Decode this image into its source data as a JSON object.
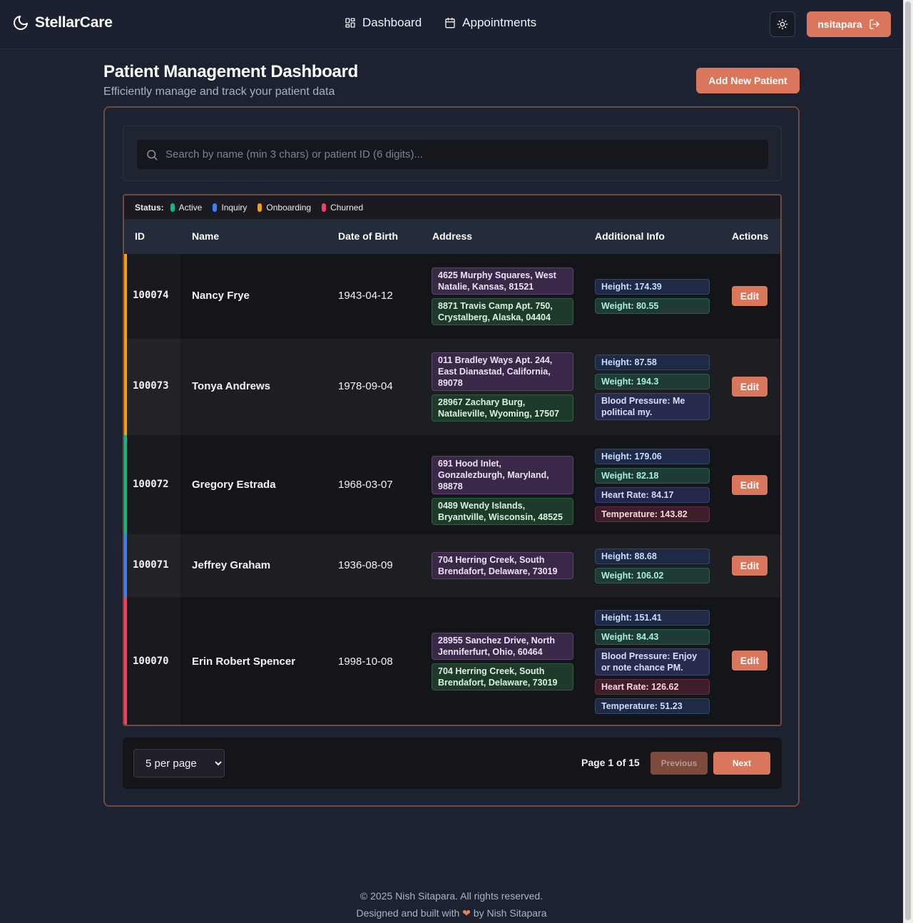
{
  "app": {
    "brand": "StellarCare",
    "nav": [
      {
        "label": "Dashboard",
        "icon": "grid-icon"
      },
      {
        "label": "Appointments",
        "icon": "calendar-icon"
      }
    ],
    "theme_toggle_icon": "sun-icon",
    "user": {
      "name": "nsitapara",
      "icon": "logout-icon"
    }
  },
  "page": {
    "title": "Patient Management Dashboard",
    "subtitle": "Efficiently manage and track your patient data",
    "add_button": "Add New Patient"
  },
  "search": {
    "placeholder": "Search by name (min 3 chars) or patient ID (6 digits)...",
    "value": ""
  },
  "legend": {
    "title": "Status:",
    "items": [
      {
        "label": "Active",
        "color": "#10b981"
      },
      {
        "label": "Inquiry",
        "color": "#3b82f6"
      },
      {
        "label": "Onboarding",
        "color": "#f59e0b"
      },
      {
        "label": "Churned",
        "color": "#f43f5e"
      }
    ]
  },
  "table": {
    "columns": [
      "ID",
      "Name",
      "Date of Birth",
      "Address",
      "Additional Info",
      "Actions"
    ],
    "edit_label": "Edit",
    "rows": [
      {
        "id": "100074",
        "name": "Nancy Frye",
        "dob": "1943-04-12",
        "status": "Onboarding",
        "addresses": [
          "4625 Murphy Squares, West Natalie, Kansas, 81521",
          "8871 Travis Camp Apt. 750, Crystalberg, Alaska, 04404"
        ],
        "info": [
          "Height: 174.39",
          "Weight: 80.55"
        ]
      },
      {
        "id": "100073",
        "name": "Tonya Andrews",
        "dob": "1978-09-04",
        "status": "Onboarding",
        "addresses": [
          "011 Bradley Ways Apt. 244, East Dianastad, California, 89078",
          "28967 Zachary Burg, Natalieville, Wyoming, 17507"
        ],
        "info": [
          "Height: 87.58",
          "Weight: 194.3",
          "Blood Pressure: Me political my."
        ]
      },
      {
        "id": "100072",
        "name": "Gregory Estrada",
        "dob": "1968-03-07",
        "status": "Active",
        "addresses": [
          "691 Hood Inlet, Gonzalezburgh, Maryland, 98878",
          "0489 Wendy Islands, Bryantville, Wisconsin, 48525"
        ],
        "info": [
          "Height: 179.06",
          "Weight: 82.18",
          "Heart Rate: 84.17",
          "Temperature: 143.82"
        ]
      },
      {
        "id": "100071",
        "name": "Jeffrey Graham",
        "dob": "1936-08-09",
        "status": "Inquiry",
        "addresses": [
          "704 Herring Creek, South Brendafort, Delaware, 73019"
        ],
        "info": [
          "Height: 88.68",
          "Weight: 106.02"
        ]
      },
      {
        "id": "100070",
        "name": "Erin Robert Spencer",
        "dob": "1998-10-08",
        "status": "Churned",
        "addresses": [
          "28955 Sanchez Drive, North Jenniferfurt, Ohio, 60464",
          "704 Herring Creek, South Brendafort, Delaware, 73019"
        ],
        "info": [
          "Height: 151.41",
          "Weight: 84.43",
          "Blood Pressure: Enjoy or note chance PM.",
          "Heart Rate: 126.62",
          "Temperature: 51.23"
        ]
      }
    ]
  },
  "pagination": {
    "per_page": "5 per page",
    "per_page_options": [
      "5 per page"
    ],
    "page_info": "Page 1 of 15",
    "previous": "Previous",
    "next": "Next"
  },
  "footer": {
    "copyright": "© 2025 Nish Sitapara. All rights reserved.",
    "built_prefix": "Designed and built with",
    "heart": "❤",
    "built_suffix": "by Nish Sitapara"
  }
}
